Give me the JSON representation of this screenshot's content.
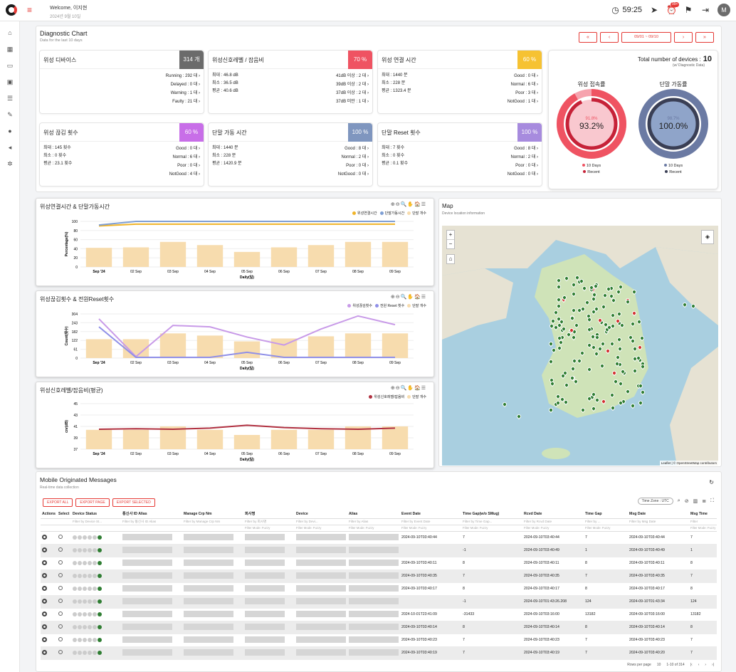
{
  "header": {
    "welcome": "Welcome, 이지현",
    "date": "2024년 9월 10일",
    "timer": "59:25",
    "badge": "99+",
    "avatar": "M"
  },
  "sidebar": {
    "items": [
      "home-icon",
      "grid-icon",
      "monitor-icon",
      "briefcase-icon",
      "server-icon",
      "wrench-icon",
      "info-icon",
      "megaphone-icon",
      "gear-icon"
    ]
  },
  "diag": {
    "title": "Diagnostic Chart",
    "subtitle": "Data for the last 10 days",
    "nav": [
      "«",
      "‹",
      "09/01 ~ 09/10",
      "›",
      "»"
    ]
  },
  "metrics": [
    {
      "title": "위성 디바이스",
      "pct": "314 개",
      "color": "#6b6b6b",
      "left": [],
      "right": [
        "Running : 292 대 ›",
        "Delayed : 0 대 ›",
        "Warning : 1 대 ›",
        "Faulty : 21 대 ›"
      ]
    },
    {
      "title": "위성신호레벨 / 잡음비",
      "pct": "70 %",
      "color": "#ef5362",
      "left": [
        "최대 : 46.8 dB",
        "최소 : 36.5 dB",
        "평균 : 40.6 dB"
      ],
      "right": [
        "41dB 이상 : 2 대 ›",
        "39dB 이상 : 2 대 ›",
        "37dB 이상 : 2 대 ›",
        "37dB 미만 : 1 대 ›"
      ]
    },
    {
      "title": "위성 연결 시간",
      "pct": "60 %",
      "color": "#f6c232",
      "left": [
        "최대 : 1440 분",
        "최소 : 228 분",
        "평균 : 1323.4 분"
      ],
      "right": [
        "Good : 0 대 ›",
        "Normal : 6 대 ›",
        "Poor : 3 대 ›",
        "NotGood : 1 대 ›"
      ]
    },
    {
      "title": "위성 끊김 횟수",
      "pct": "60 %",
      "color": "#c86ee8",
      "left": [
        "최대 : 145 횟수",
        "최소 : 0 횟수",
        "평균 : 23.1 횟수"
      ],
      "right": [
        "Good : 0 대 ›",
        "Normal : 6 대 ›",
        "Poor : 0 대 ›",
        "NotGood : 4 대 ›"
      ]
    },
    {
      "title": "단말 가동 시간",
      "pct": "100 %",
      "color": "#7f96bf",
      "left": [
        "최대 : 1440 분",
        "최소 : 228 분",
        "평균 : 1420.9 분"
      ],
      "right": [
        "Good : 8 대 ›",
        "Normal : 2 대 ›",
        "Poor : 0 대 ›",
        "NotGood : 0 대 ›"
      ]
    },
    {
      "title": "단말 Reset 횟수",
      "pct": "100 %",
      "color": "#a78bde",
      "left": [
        "최대 : 7 횟수",
        "최소 : 0 횟수",
        "평균 : 0.1 횟수"
      ],
      "right": [
        "Good : 8 대 ›",
        "Normal : 2 대 ›",
        "Poor : 0 대 ›",
        "NotGood : 0 대 ›"
      ]
    }
  ],
  "total": {
    "label": "Total number of devices :",
    "value": "10",
    "sub": "(w/ Diagnostic Data)",
    "donuts": [
      {
        "title": "위성 접속률",
        "small": "91.8%",
        "big": "93.2%",
        "legend": [
          "10 Days",
          "Recent"
        ]
      },
      {
        "title": "단말 가동률",
        "small": "98.7%",
        "big": "100.0%",
        "legend": [
          "10 Days",
          "Recent"
        ]
      }
    ]
  },
  "chart_data": [
    {
      "type": "bar",
      "title": "위성연결시간 & 단말가동시간",
      "categories": [
        "Sep '24",
        "02 Sep",
        "03 Sep",
        "04 Sep",
        "05 Sep",
        "06 Sep",
        "07 Sep",
        "08 Sep",
        "09 Sep"
      ],
      "series": [
        {
          "name": "위성연결시간",
          "type": "line",
          "values": [
            90,
            94,
            94,
            94,
            94,
            94,
            94,
            94,
            94
          ]
        },
        {
          "name": "단말가동시간",
          "type": "line",
          "values": [
            92,
            100,
            100,
            100,
            100,
            100,
            100,
            100,
            100
          ]
        },
        {
          "name": "단말 개수",
          "type": "bar",
          "values": [
            42,
            43,
            55,
            48,
            33,
            43,
            48,
            55,
            55
          ]
        }
      ],
      "xlabel": "Daily(일)",
      "ylabel": "Percentage(%)",
      "yticks": [
        "100",
        "80",
        "60",
        "40",
        "20",
        "0"
      ],
      "tools": "⊕⊖🔍✋🏠☰"
    },
    {
      "type": "bar",
      "title": "위성끊김횟수 & 전원Reset횟수",
      "categories": [
        "Sep '24",
        "02 Sep",
        "03 Sep",
        "04 Sep",
        "05 Sep",
        "06 Sep",
        "07 Sep",
        "08 Sep",
        "09 Sep"
      ],
      "series": [
        {
          "name": "위성끊김횟수",
          "type": "line",
          "values": [
            270,
            10,
            225,
            215,
            145,
            90,
            200,
            290,
            230
          ]
        },
        {
          "name": "전원 Reset 횟수",
          "type": "line",
          "values": [
            215,
            5,
            5,
            5,
            40,
            5,
            5,
            5,
            5
          ]
        },
        {
          "name": "단말 개수",
          "type": "bar",
          "values": [
            130,
            130,
            170,
            155,
            115,
            135,
            150,
            170,
            170
          ]
        }
      ],
      "xlabel": "Daily(일)",
      "ylabel": "Count(횟수)",
      "yticks": [
        "304",
        "243",
        "182",
        "122",
        "61",
        "0"
      ],
      "tools": "⊕⊖🔍✋🏠☰"
    },
    {
      "type": "bar",
      "title": "위성신호레벨/잡음비(평균)",
      "categories": [
        "Sep '24",
        "02 Sep",
        "03 Sep",
        "04 Sep",
        "05 Sep",
        "06 Sep",
        "07 Sep",
        "08 Sep",
        "09 Sep"
      ],
      "series": [
        {
          "name": "위성신호레벨/잡음비",
          "type": "line",
          "values": [
            40.5,
            40.6,
            40.5,
            40.7,
            41.2,
            40.8,
            40.6,
            40.5,
            40.7
          ]
        },
        {
          "name": "단말 개수",
          "type": "bar",
          "values": [
            40.4,
            40.4,
            41,
            40.4,
            39.5,
            40.4,
            40.4,
            41,
            41
          ]
        }
      ],
      "xlabel": "Daily(일)",
      "ylabel": "cnr(dB)",
      "yticks": [
        "45",
        "43",
        "41",
        "39",
        "37"
      ],
      "tools": "⊕⊖🔍✋🏠☰"
    }
  ],
  "map": {
    "title": "Map",
    "subtitle": "Device location information",
    "attr": "Leaflet | © OpenStreetMap contributors"
  },
  "messages": {
    "title": "Mobile Originated Messages",
    "subtitle": "Real-time data collection",
    "buttons": [
      "EXPORT ALL",
      "EXPORT PAGE",
      "EXPORT SELECTED"
    ],
    "timezone": "Time Zone : UTC",
    "columns": [
      "Actions",
      "Select",
      "Device Status",
      "통신사 ID Alias",
      "Manage Crp Nm",
      "회사명",
      "Device",
      "Alias",
      "Event Date",
      "Time Gap(w/o SMug)",
      "Rcvd Date",
      "Time Gap",
      "Msg Date",
      "Msg Time"
    ],
    "filters": [
      "",
      "",
      "Filter by Device St...",
      "Filter by 통신사 ID Alias",
      "Filter by Manage Crp Nm",
      "Filter by 회사명",
      "Filter by Devi...",
      "Filter by Alias",
      "Filter by Event Date",
      "Filter by Time Gap...",
      "Filter by Rcvd Date",
      "Filter by ...",
      "Filter by Msg Date",
      "Filter"
    ],
    "rows": [
      [
        "2024-09-10T03:40:44",
        "7",
        "2024-09-10T03:40:44",
        "7",
        "2024-09-10T03:40:44",
        "7"
      ],
      [
        "",
        "-1",
        "2024-09-10T03:40:49",
        "1",
        "2024-09-10T03:40:49",
        "1"
      ],
      [
        "2024-09-10T03:40:11",
        "8",
        "2024-09-10T03:40:11",
        "8",
        "2024-09-10T03:40:11",
        "8"
      ],
      [
        "2024-09-10T03:40:35",
        "7",
        "2024-09-10T03:40:35",
        "7",
        "2024-09-10T03:40:35",
        "7"
      ],
      [
        "2024-09-10T03:40:17",
        "8",
        "2024-09-10T03:40:17",
        "8",
        "2024-09-10T03:40:17",
        "8"
      ],
      [
        "",
        "-1",
        "2024-09-10T01:43:26.208",
        "124",
        "2024-09-10T01:43:34",
        "124"
      ],
      [
        "2024-10-01T23:41:09",
        "-31433",
        "2024-09-10T03:16:00",
        "13182",
        "2024-09-10T03:16:00",
        "13182"
      ],
      [
        "2024-09-10T03:40:14",
        "8",
        "2024-09-10T03:40:14",
        "8",
        "2024-09-10T03:40:14",
        "8"
      ],
      [
        "2024-09-10T03:40:23",
        "7",
        "2024-09-10T03:40:23",
        "7",
        "2024-09-10T03:40:23",
        "7"
      ],
      [
        "2024-09-10T03:40:19",
        "7",
        "2024-09-10T03:40:19",
        "7",
        "2024-09-10T03:40:20",
        "7"
      ]
    ],
    "pagination": {
      "rows_label": "Rows per page",
      "rows": "10",
      "range": "1-10 of 314"
    }
  }
}
